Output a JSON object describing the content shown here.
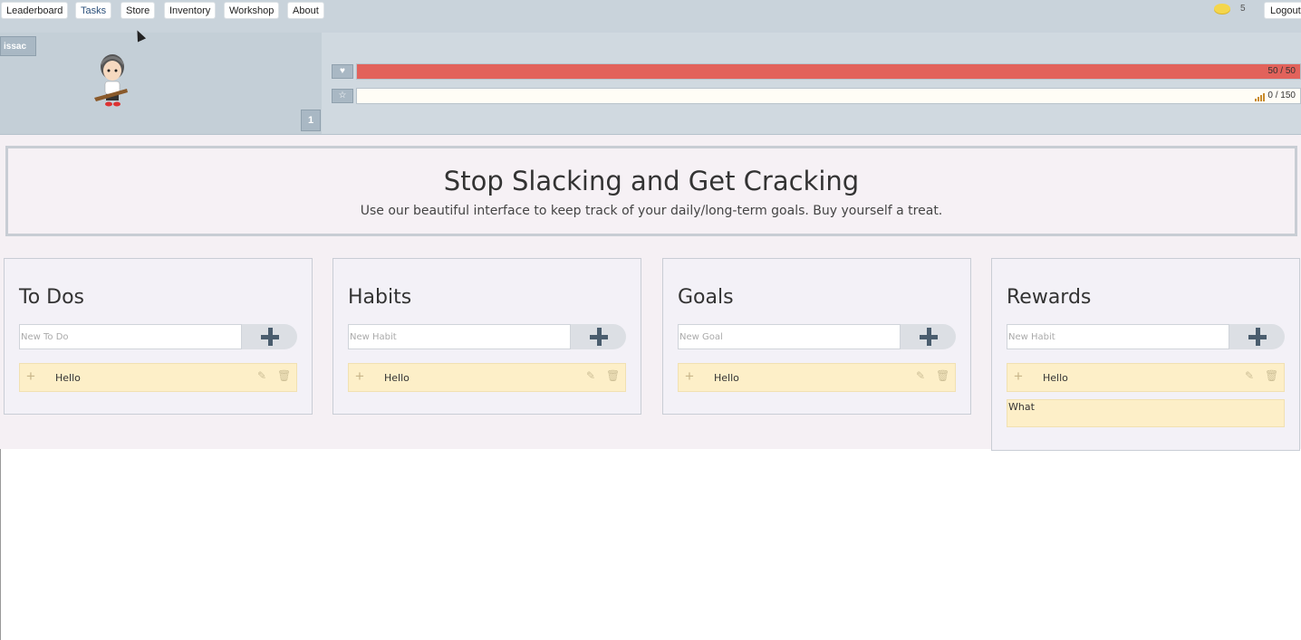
{
  "nav": {
    "items": [
      {
        "label": "Leaderboard",
        "active": false
      },
      {
        "label": "Tasks",
        "active": true
      },
      {
        "label": "Store",
        "active": false
      },
      {
        "label": "Inventory",
        "active": false
      },
      {
        "label": "Workshop",
        "active": false
      },
      {
        "label": "About",
        "active": false
      }
    ],
    "gold": "5",
    "logout_label": "Logout"
  },
  "profile": {
    "name": "issac",
    "level": "1",
    "health": {
      "current": 50,
      "max": 50,
      "text": "50 / 50",
      "icon": "heart-icon",
      "color": "#e2625b"
    },
    "experience": {
      "current": 0,
      "max": 150,
      "text": "0 / 150",
      "icon": "star-icon"
    }
  },
  "hero": {
    "title": "Stop Slacking and Get Cracking",
    "subtitle": "Use our beautiful interface to keep track of your daily/long-term goals. Buy yourself a treat."
  },
  "columns": [
    {
      "title": "To Dos",
      "placeholder": "New To Do",
      "items": [
        "Hello"
      ],
      "extra_items": []
    },
    {
      "title": "Habits",
      "placeholder": "New Habit",
      "items": [
        "Hello"
      ],
      "extra_items": []
    },
    {
      "title": "Goals",
      "placeholder": "New Goal",
      "items": [
        "Hello"
      ],
      "extra_items": []
    },
    {
      "title": "Rewards",
      "placeholder": "New Habit",
      "items": [
        "Hello"
      ],
      "extra_items": [
        "What"
      ]
    }
  ]
}
